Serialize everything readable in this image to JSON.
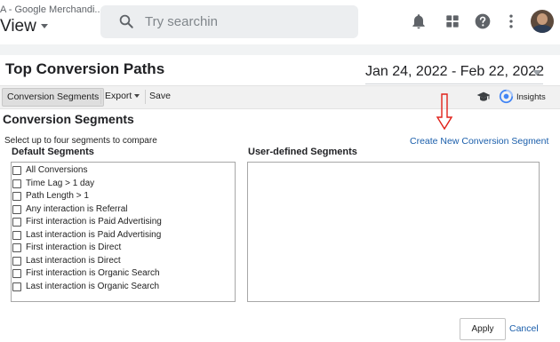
{
  "header": {
    "account_name": "A - Google Merchandi...",
    "view_label": "View",
    "search_placeholder": "Try searchin"
  },
  "report": {
    "title": "Top Conversion Paths",
    "date_range": "Jan 24, 2022 - Feb 22, 2022"
  },
  "toolbar": {
    "conversion_segments_label": "Conversion Segments",
    "export_label": "Export",
    "save_label": "Save",
    "insights_label": "Insights"
  },
  "panel": {
    "title": "Conversion Segments",
    "instructions": "Select up to four segments to compare",
    "create_link": "Create New Conversion Segment",
    "default_heading": "Default Segments",
    "user_heading": "User-defined Segments",
    "default_segments": [
      {
        "label": "All Conversions",
        "checked": false
      },
      {
        "label": "Time Lag > 1 day",
        "checked": false
      },
      {
        "label": "Path Length > 1",
        "checked": false
      },
      {
        "label": "Any interaction is Referral",
        "checked": false
      },
      {
        "label": "First interaction is Paid Advertising",
        "checked": false
      },
      {
        "label": "Last interaction is Paid Advertising",
        "checked": false
      },
      {
        "label": "First interaction is Direct",
        "checked": false
      },
      {
        "label": "Last interaction is Direct",
        "checked": false
      },
      {
        "label": "First interaction is Organic Search",
        "checked": false
      },
      {
        "label": "Last interaction is Organic Search",
        "checked": false
      }
    ],
    "apply_label": "Apply",
    "cancel_label": "Cancel"
  },
  "icons": {
    "search": "search-icon",
    "notifications": "bell-icon",
    "apps": "apps-grid-icon",
    "help": "help-icon",
    "more": "more-vert-icon",
    "education": "graduation-cap-icon",
    "insights": "insights-icon",
    "annotation": "red-arrow-icon"
  },
  "colors": {
    "link": "#1a5eab",
    "annotation_arrow": "#e0221b",
    "toolbar_bg": "#f1f1f1",
    "search_bg": "#eceef0"
  }
}
